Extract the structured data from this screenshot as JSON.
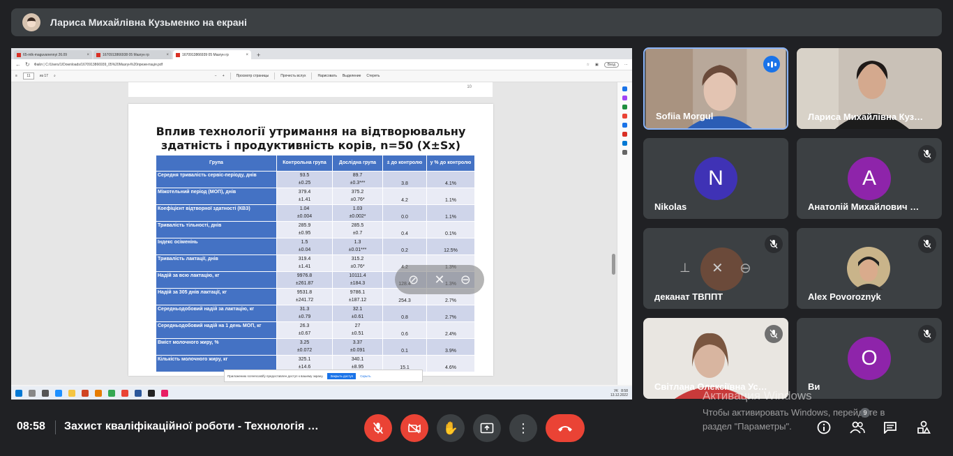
{
  "presenter_bar": {
    "title": "Лариса Михайлівна Кузьменко на екрані"
  },
  "browser": {
    "tabs": [
      {
        "label": "65-mlk-maguvanennyi 26.09",
        "active": false
      },
      {
        "label": "1670913866938 05 Мазгун гр",
        "active": false
      },
      {
        "label": "1670913866939 05 Мазгун гр",
        "active": true
      }
    ],
    "address": "Файл  |  C:/Users/1/Downloads/1670913866939_05%20Мазгун%20презентація.pdf",
    "profile_pill": "Вход",
    "pdf_toolbar": {
      "page_current": "11",
      "page_total": "из 17",
      "view_label": "Просмотр страницы",
      "read_aloud": "Прочесть вслух",
      "draw": "Нарисовать",
      "highlight": "Выделение",
      "erase": "Стереть"
    },
    "prev_page_number": "10",
    "notice": {
      "text": "Приложению screencastify предоставлен доступ к вашему экрану.",
      "stop_button": "Закрыть доступ",
      "hide_link": "Скрыть"
    },
    "taskbar": {
      "lang": "УК",
      "time": "8:58",
      "date": "13.12.2022"
    }
  },
  "slide": {
    "title_line1": "Вплив технології утримання на відтворювальну",
    "title_line2": "здатність і продуктивність корів, n=50 (X±Sx)",
    "columns": [
      "Група",
      "Контрольна група",
      "Дослідна група",
      "± до контролю",
      "у % до контролю"
    ],
    "rows": [
      {
        "label": "Середня тривалість сервіс-періоду, днів",
        "c1": "93.5",
        "c1b": "±0.25",
        "c2": "89.7",
        "c2b": "±0.3***",
        "d": "3.8",
        "p": "4.1%"
      },
      {
        "label": "Міжотельний період (МОП), днів",
        "c1": "379.4",
        "c1b": "±1.41",
        "c2": "375.2",
        "c2b": "±0.76*",
        "d": "4.2",
        "p": "1.1%"
      },
      {
        "label": "Коефіцієнт відтворної здатності (КВЗ)",
        "c1": "1.04",
        "c1b": "±0.004",
        "c2": "1.03",
        "c2b": "±0.002*",
        "d": "0.0",
        "p": "1.1%"
      },
      {
        "label": "Тривалість тільності, днів",
        "c1": "285.9",
        "c1b": "±0.95",
        "c2": "285.5",
        "c2b": "±0.7",
        "d": "0.4",
        "p": "0.1%"
      },
      {
        "label": "Індекс осіменінь",
        "c1": "1.5",
        "c1b": "±0.04",
        "c2": "1.3",
        "c2b": "±0.01***",
        "d": "0.2",
        "p": "12.5%"
      },
      {
        "label": "Тривалість лактації, днів",
        "c1": "319.4",
        "c1b": "±1.41",
        "c2": "315.2",
        "c2b": "±0.76*",
        "d": "4.2",
        "p": "1.3%"
      },
      {
        "label": "Надій за всю лактацію, кг",
        "c1": "9976.8",
        "c1b": "±261.87",
        "c2": "10111.4",
        "c2b": "±184.3",
        "d": "128.4",
        "p": "1.3%"
      },
      {
        "label": "Надій за 305 днів лактації, кг",
        "c1": "9531.8",
        "c1b": "±241.72",
        "c2": "9786.1",
        "c2b": "±187.12",
        "d": "254.3",
        "p": "2.7%"
      },
      {
        "label": "Середньодобовий надій за лактацію, кг",
        "c1": "31.3",
        "c1b": "±0.79",
        "c2": "32.1",
        "c2b": "±0.61",
        "d": "0.8",
        "p": "2.7%"
      },
      {
        "label": "Середньодобовий надій на 1 день МОП, кг",
        "c1": "26.3",
        "c1b": "±0.67",
        "c2": "27",
        "c2b": "±0.51",
        "d": "0.6",
        "p": "2.4%"
      },
      {
        "label": "Вміст молочного жиру, %",
        "c1": "3.25",
        "c1b": "±0.072",
        "c2": "3.37",
        "c2b": "±0.091",
        "d": "0.1",
        "p": "3.9%"
      },
      {
        "label": "Кількість молочного жиру, кг",
        "c1": "325.1",
        "c1b": "±14.6",
        "c2": "340.1",
        "c2b": "±8.95",
        "d": "15.1",
        "p": "4.6%"
      }
    ]
  },
  "participants": [
    {
      "name": "Sofiia Morgul",
      "type": "video",
      "speaking": true
    },
    {
      "name": "Лариса Михайлівна Куз…",
      "type": "video"
    },
    {
      "name": "Nikolas",
      "initial": "N",
      "color": "#3f32b5"
    },
    {
      "name": "Анатолій Михайлович …",
      "initial": "A",
      "color": "#8e24aa",
      "muted": true
    },
    {
      "name": "деканат ТВППТ",
      "type": "video",
      "muted": true
    },
    {
      "name": "Alex Povoroznyk",
      "type": "avatar",
      "muted": true
    },
    {
      "name": "Світлана Олексіївна Ус…",
      "type": "video",
      "muted": true
    },
    {
      "name": "Ви",
      "initial": "O",
      "color": "#8e24aa",
      "muted": true
    }
  ],
  "bottom_bar": {
    "time": "08:58",
    "meeting_title": "Захист кваліфікаційної роботи - Технологія …",
    "participants_count": "9"
  },
  "watermark": {
    "line1": "Активация Windows",
    "line2": "Чтобы активировать Windows, перейдите в",
    "line3": "раздел \"Параметры\"."
  }
}
